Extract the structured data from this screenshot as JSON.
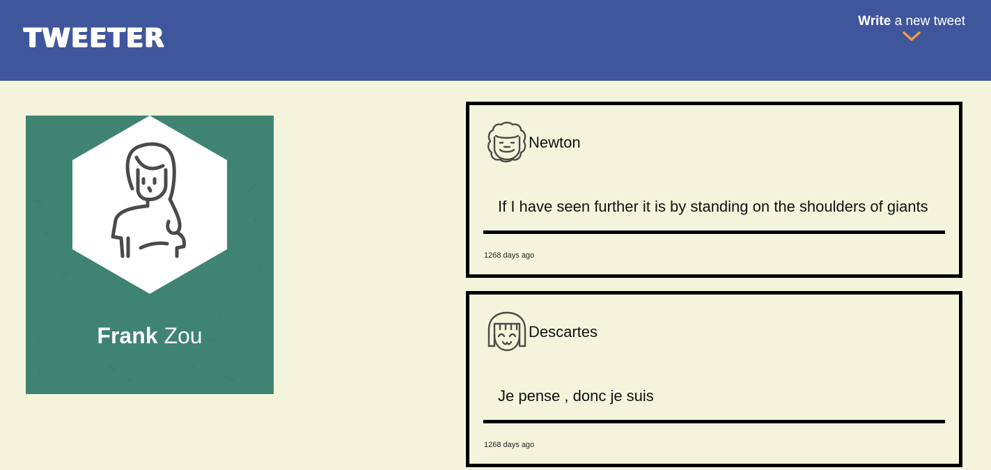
{
  "header": {
    "logo": "TWEETER",
    "compose_bold": "Write",
    "compose_rest": " a new tweet",
    "chevron_icon": "chevron-down-icon",
    "colors": {
      "bar": "#40569c",
      "accent": "#f0a03c"
    }
  },
  "profile": {
    "first_name": "Frank",
    "last_name": " Zou",
    "avatar_icon": "girl-avatar-icon",
    "colors": {
      "card": "#3f8373"
    }
  },
  "tweets": [
    {
      "author": "Newton",
      "avatar_icon": "curly-hair-avatar-icon",
      "content": "If I have seen further it is by standing on the shoulders of giants",
      "time": "1268 days ago"
    },
    {
      "author": "Descartes",
      "avatar_icon": "bob-hair-avatar-icon",
      "content": "Je pense , donc je suis",
      "time": "1268 days ago"
    }
  ]
}
